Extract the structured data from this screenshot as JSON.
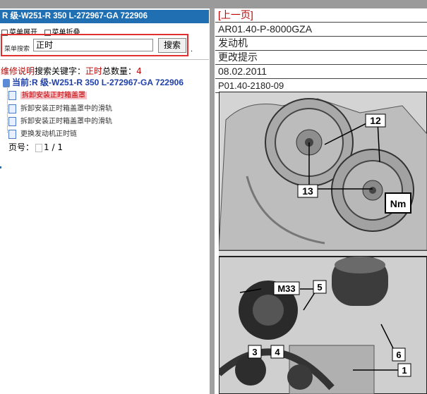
{
  "left": {
    "title": "R 级-W251-R 350 L-272967-GA 722906",
    "menu": {
      "expand": "菜单展开",
      "collapse": "菜单折叠"
    },
    "search": {
      "label": "菜单搜索",
      "value": "正时",
      "button": "搜索"
    },
    "result": {
      "prefix": "维修说明",
      "keyword_label": "搜索关键字：",
      "keyword": "正时",
      "count_label": "总数量：",
      "count": "4"
    },
    "current": "当前:R 级-W251-R 350 L-272967-GA 722906",
    "items": [
      {
        "label": "拆卸安装正时箱盖罩"
      },
      {
        "label": "拆卸安装正时箱盖罩中的滑轨"
      },
      {
        "label": "拆卸安装正时箱盖罩中的滑轨"
      },
      {
        "label": "更换发动机正时链"
      }
    ],
    "pager": {
      "label": "页号：",
      "value": "1 / 1"
    }
  },
  "right": {
    "prev": "[上一页]",
    "code": "AR01.40-P-8000GZA",
    "subject": "发动机",
    "note": "更改提示",
    "date": "08.02.2011",
    "figure": "P01.40-2180-09"
  },
  "figure_labels": {
    "top": [
      "12",
      "13",
      "Nm"
    ],
    "bottom": [
      "M33",
      "5",
      "3",
      "4",
      "6",
      "1"
    ]
  }
}
